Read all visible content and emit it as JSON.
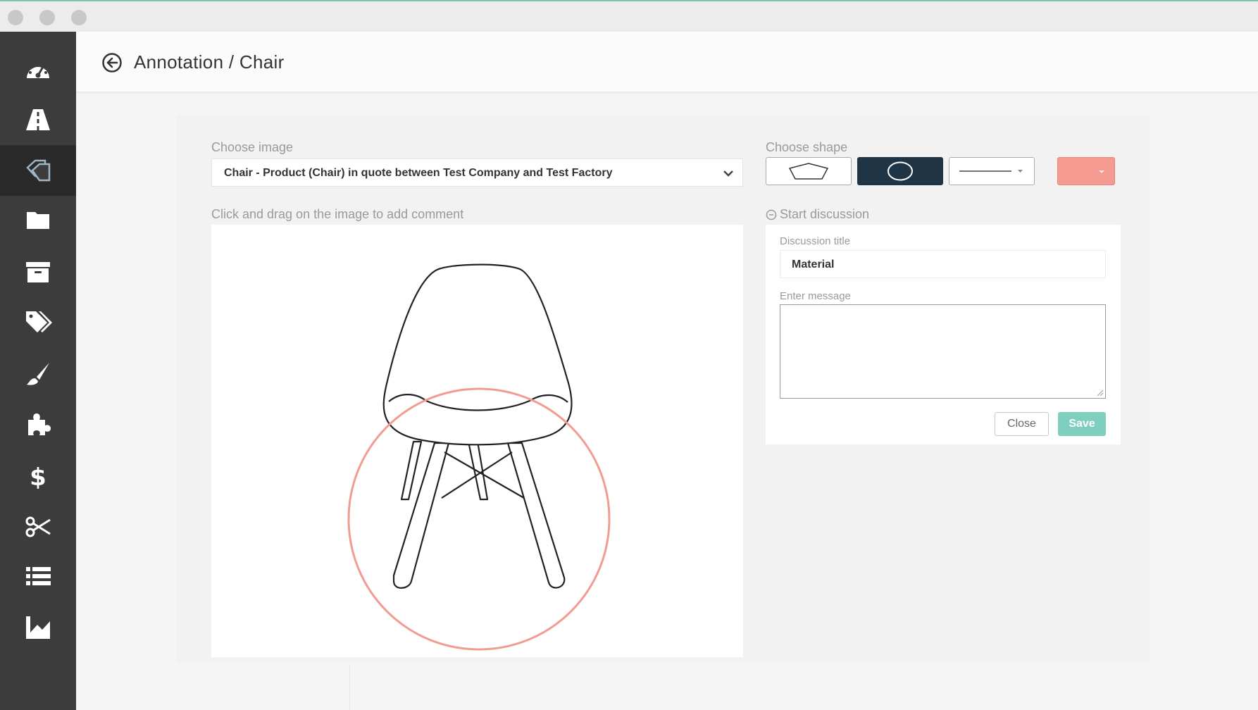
{
  "window": {
    "traffic_lights": [
      "close",
      "minimize",
      "zoom"
    ]
  },
  "sidebar": {
    "items": [
      {
        "icon": "dashboard-icon",
        "active": false
      },
      {
        "icon": "road-icon",
        "active": false
      },
      {
        "icon": "annotation-icon",
        "active": true
      },
      {
        "icon": "folder-icon",
        "active": false
      },
      {
        "icon": "archive-icon",
        "active": false
      },
      {
        "icon": "tags-icon",
        "active": false
      },
      {
        "icon": "paintbrush-icon",
        "active": false
      },
      {
        "icon": "puzzle-icon",
        "active": false
      },
      {
        "icon": "dollar-icon",
        "active": false
      },
      {
        "icon": "scissors-icon",
        "active": false
      },
      {
        "icon": "list-icon",
        "active": false
      },
      {
        "icon": "chart-icon",
        "active": false
      }
    ]
  },
  "header": {
    "title": "Annotation / Chair"
  },
  "image_section": {
    "label": "Choose image",
    "selected_value": "Chair - Product (Chair) in quote between Test Company and Test Factory",
    "instruction": "Click and drag on the image to add comment"
  },
  "shape_section": {
    "label": "Choose shape",
    "shapes": [
      "pentagon",
      "circle",
      "line"
    ],
    "selected_shape": "circle",
    "color": "#f49a90"
  },
  "discussion": {
    "start_label": "Start discussion",
    "title_label": "Discussion title",
    "title_value": "Material",
    "message_label": "Enter message",
    "message_value": "",
    "close_label": "Close",
    "save_label": "Save"
  },
  "colors": {
    "sidebar_bg": "#3c3c3c",
    "selected_shape_bg": "#1f3445",
    "save_button": "#7fcfbe",
    "annotation_color": "#f49a90"
  }
}
